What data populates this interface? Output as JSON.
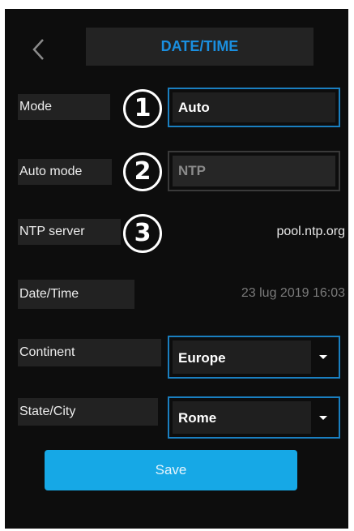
{
  "header": {
    "back_icon": "chevron-left-icon",
    "title": "DATE/TIME"
  },
  "rows": {
    "mode": {
      "label": "Mode",
      "badge": "1",
      "value": "Auto"
    },
    "auto_mode": {
      "label": "Auto mode",
      "badge": "2",
      "value": "NTP"
    },
    "ntp_server": {
      "label": "NTP server",
      "badge": "3",
      "value": "pool.ntp.org"
    },
    "date_time": {
      "label": "Date/Time",
      "value": "23 lug 2019 16:03"
    },
    "continent": {
      "label": "Continent",
      "value": "Europe"
    },
    "state_city": {
      "label": "State/City",
      "value": "Rome"
    }
  },
  "actions": {
    "save_label": "Save"
  },
  "colors": {
    "accent": "#1a8fe0",
    "button": "#16a8e6",
    "background": "#0d0d0d"
  }
}
